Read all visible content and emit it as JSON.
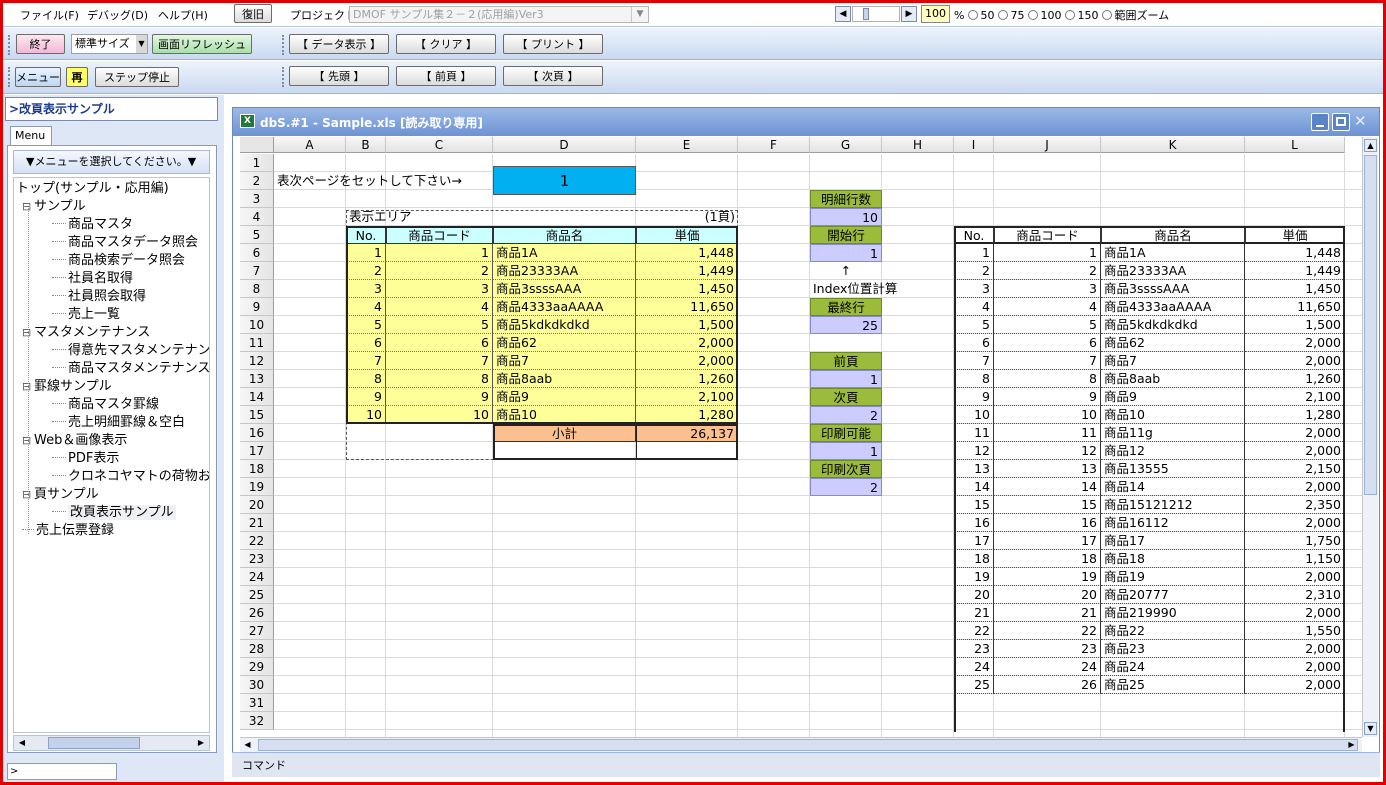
{
  "menu": {
    "file": "ファイル(F)",
    "debug": "デバッグ(D)",
    "help": "ヘルプ(H)",
    "restore": "復旧",
    "project_label": "プロジェクト:",
    "project_value": "DMOF サンプル集２－２(応用編)Ver3"
  },
  "zoom": {
    "value": "100",
    "percent": "%",
    "opt50": "50",
    "opt75": "75",
    "opt100": "100",
    "opt150": "150",
    "range": "範囲ズーム"
  },
  "toolbar1": {
    "exit": "終了",
    "size": "標準サイズ",
    "refresh": "画面リフレッシュ",
    "data_show": "【 データ表示 】",
    "clear": "【 クリア 】",
    "print": "【 プリント 】"
  },
  "toolbar2": {
    "menu": "メニュー",
    "replay": "再",
    "step_stop": "ステップ停止",
    "first": "【 先頭 】",
    "prev": "【 前頁 】",
    "next": "【 次頁 】"
  },
  "left": {
    "title": ">改頁表示サンプル",
    "tab": "Menu",
    "select": "▼メニューを選択してください。▼"
  },
  "tree": [
    {
      "label": "トップ(サンプル・応用編)",
      "level": 0,
      "expander": ""
    },
    {
      "label": "サンプル",
      "level": 1,
      "expander": "⊟"
    },
    {
      "label": "商品マスタ",
      "level": 2,
      "expander": ""
    },
    {
      "label": "商品マスタデータ照会",
      "level": 2,
      "expander": ""
    },
    {
      "label": "商品検索データ照会",
      "level": 2,
      "expander": ""
    },
    {
      "label": "社員名取得",
      "level": 2,
      "expander": ""
    },
    {
      "label": "社員照会取得",
      "level": 2,
      "expander": ""
    },
    {
      "label": "売上一覧",
      "level": 2,
      "expander": ""
    },
    {
      "label": "マスタメンテナンス",
      "level": 1,
      "expander": "⊟"
    },
    {
      "label": "得意先マスタメンテナンス",
      "level": 2,
      "expander": ""
    },
    {
      "label": "商品マスタメンテナンス",
      "level": 2,
      "expander": ""
    },
    {
      "label": "罫線サンプル",
      "level": 1,
      "expander": "⊟"
    },
    {
      "label": "商品マスタ罫線",
      "level": 2,
      "expander": ""
    },
    {
      "label": "売上明細罫線＆空白",
      "level": 2,
      "expander": ""
    },
    {
      "label": "Web＆画像表示",
      "level": 1,
      "expander": "⊟"
    },
    {
      "label": "PDF表示",
      "level": 2,
      "expander": ""
    },
    {
      "label": "クロネコヤマトの荷物お問い",
      "level": 2,
      "expander": ""
    },
    {
      "label": "頁サンプル",
      "level": 1,
      "expander": "⊟"
    },
    {
      "label": "改頁表示サンプル",
      "level": 2,
      "expander": "",
      "selected": true
    },
    {
      "label": "売上伝票登録",
      "level": 1,
      "expander": ""
    }
  ],
  "window": {
    "title": "dbS.#1 - Sample.xls [読み取り専用]"
  },
  "cols": [
    "A",
    "B",
    "C",
    "D",
    "E",
    "F",
    "G",
    "H",
    "I",
    "J",
    "K",
    "L"
  ],
  "rows": [
    "1",
    "2",
    "3",
    "4",
    "5",
    "6",
    "7",
    "8",
    "9",
    "10",
    "11",
    "12",
    "13",
    "14",
    "15",
    "16",
    "17",
    "18",
    "19",
    "20",
    "21",
    "22",
    "23",
    "24",
    "25",
    "26",
    "27",
    "28",
    "29",
    "30",
    "31",
    "32"
  ],
  "sheet": {
    "prompt": "表次ページをセットして下さい→",
    "page_input": "1",
    "area_title": "表示エリア",
    "page_label": "(1頁)",
    "headers": [
      "No.",
      "商品コード",
      "商品名",
      "単価"
    ],
    "subtotal_label": "小計",
    "subtotal_value": "26,137",
    "index_arrow": "↑",
    "index_label": "Index位置計算"
  },
  "left_table": [
    [
      "1",
      "1",
      "商品1A",
      "1,448"
    ],
    [
      "2",
      "2",
      "商品23333AA",
      "1,449"
    ],
    [
      "3",
      "3",
      "商品3ssssAAA",
      "1,450"
    ],
    [
      "4",
      "4",
      "商品4333aaAAAA",
      "11,650"
    ],
    [
      "5",
      "5",
      "商品5kdkdkdkd",
      "1,500"
    ],
    [
      "6",
      "6",
      "商品62",
      "2,000"
    ],
    [
      "7",
      "7",
      "商品7",
      "2,000"
    ],
    [
      "8",
      "8",
      "商品8aab",
      "1,260"
    ],
    [
      "9",
      "9",
      "商品9",
      "2,100"
    ],
    [
      "10",
      "10",
      "商品10",
      "1,280"
    ]
  ],
  "params": [
    {
      "label": "明細行数",
      "value": "10"
    },
    {
      "label": "開始行",
      "value": "1"
    },
    {
      "label": "最終行",
      "value": "25"
    },
    {
      "label": "前頁",
      "value": "1"
    },
    {
      "label": "次頁",
      "value": "2"
    },
    {
      "label": "印刷可能",
      "value": "1"
    },
    {
      "label": "印刷次頁",
      "value": "2"
    }
  ],
  "right_table": [
    [
      "1",
      "1",
      "商品1A",
      "1,448"
    ],
    [
      "2",
      "2",
      "商品23333AA",
      "1,449"
    ],
    [
      "3",
      "3",
      "商品3ssssAAA",
      "1,450"
    ],
    [
      "4",
      "4",
      "商品4333aaAAAA",
      "11,650"
    ],
    [
      "5",
      "5",
      "商品5kdkdkdkd",
      "1,500"
    ],
    [
      "6",
      "6",
      "商品62",
      "2,000"
    ],
    [
      "7",
      "7",
      "商品7",
      "2,000"
    ],
    [
      "8",
      "8",
      "商品8aab",
      "1,260"
    ],
    [
      "9",
      "9",
      "商品9",
      "2,100"
    ],
    [
      "10",
      "10",
      "商品10",
      "1,280"
    ],
    [
      "11",
      "11",
      "商品11g",
      "2,000"
    ],
    [
      "12",
      "12",
      "商品12",
      "2,000"
    ],
    [
      "13",
      "13",
      "商品13555",
      "2,150"
    ],
    [
      "14",
      "14",
      "商品14",
      "2,000"
    ],
    [
      "15",
      "15",
      "商品15121212",
      "2,350"
    ],
    [
      "16",
      "16",
      "商品16112",
      "2,000"
    ],
    [
      "17",
      "17",
      "商品17",
      "1,750"
    ],
    [
      "18",
      "18",
      "商品18",
      "1,150"
    ],
    [
      "19",
      "19",
      "商品19",
      "2,000"
    ],
    [
      "20",
      "20",
      "商品20777",
      "2,310"
    ],
    [
      "21",
      "21",
      "商品219990",
      "2,000"
    ],
    [
      "22",
      "22",
      "商品22",
      "1,550"
    ],
    [
      "23",
      "23",
      "商品23",
      "2,000"
    ],
    [
      "24",
      "24",
      "商品24",
      "2,000"
    ],
    [
      "25",
      "26",
      "商品25",
      "2,000"
    ]
  ],
  "status": {
    "command": "コマンド"
  },
  "colors": {
    "yellow": "#ffff99",
    "cyan": "#00b0f0",
    "lightcyan": "#ccffff",
    "green": "#9bbb3b",
    "lavender": "#ccccff",
    "orange": "#fac090",
    "frame": "#e00000"
  }
}
